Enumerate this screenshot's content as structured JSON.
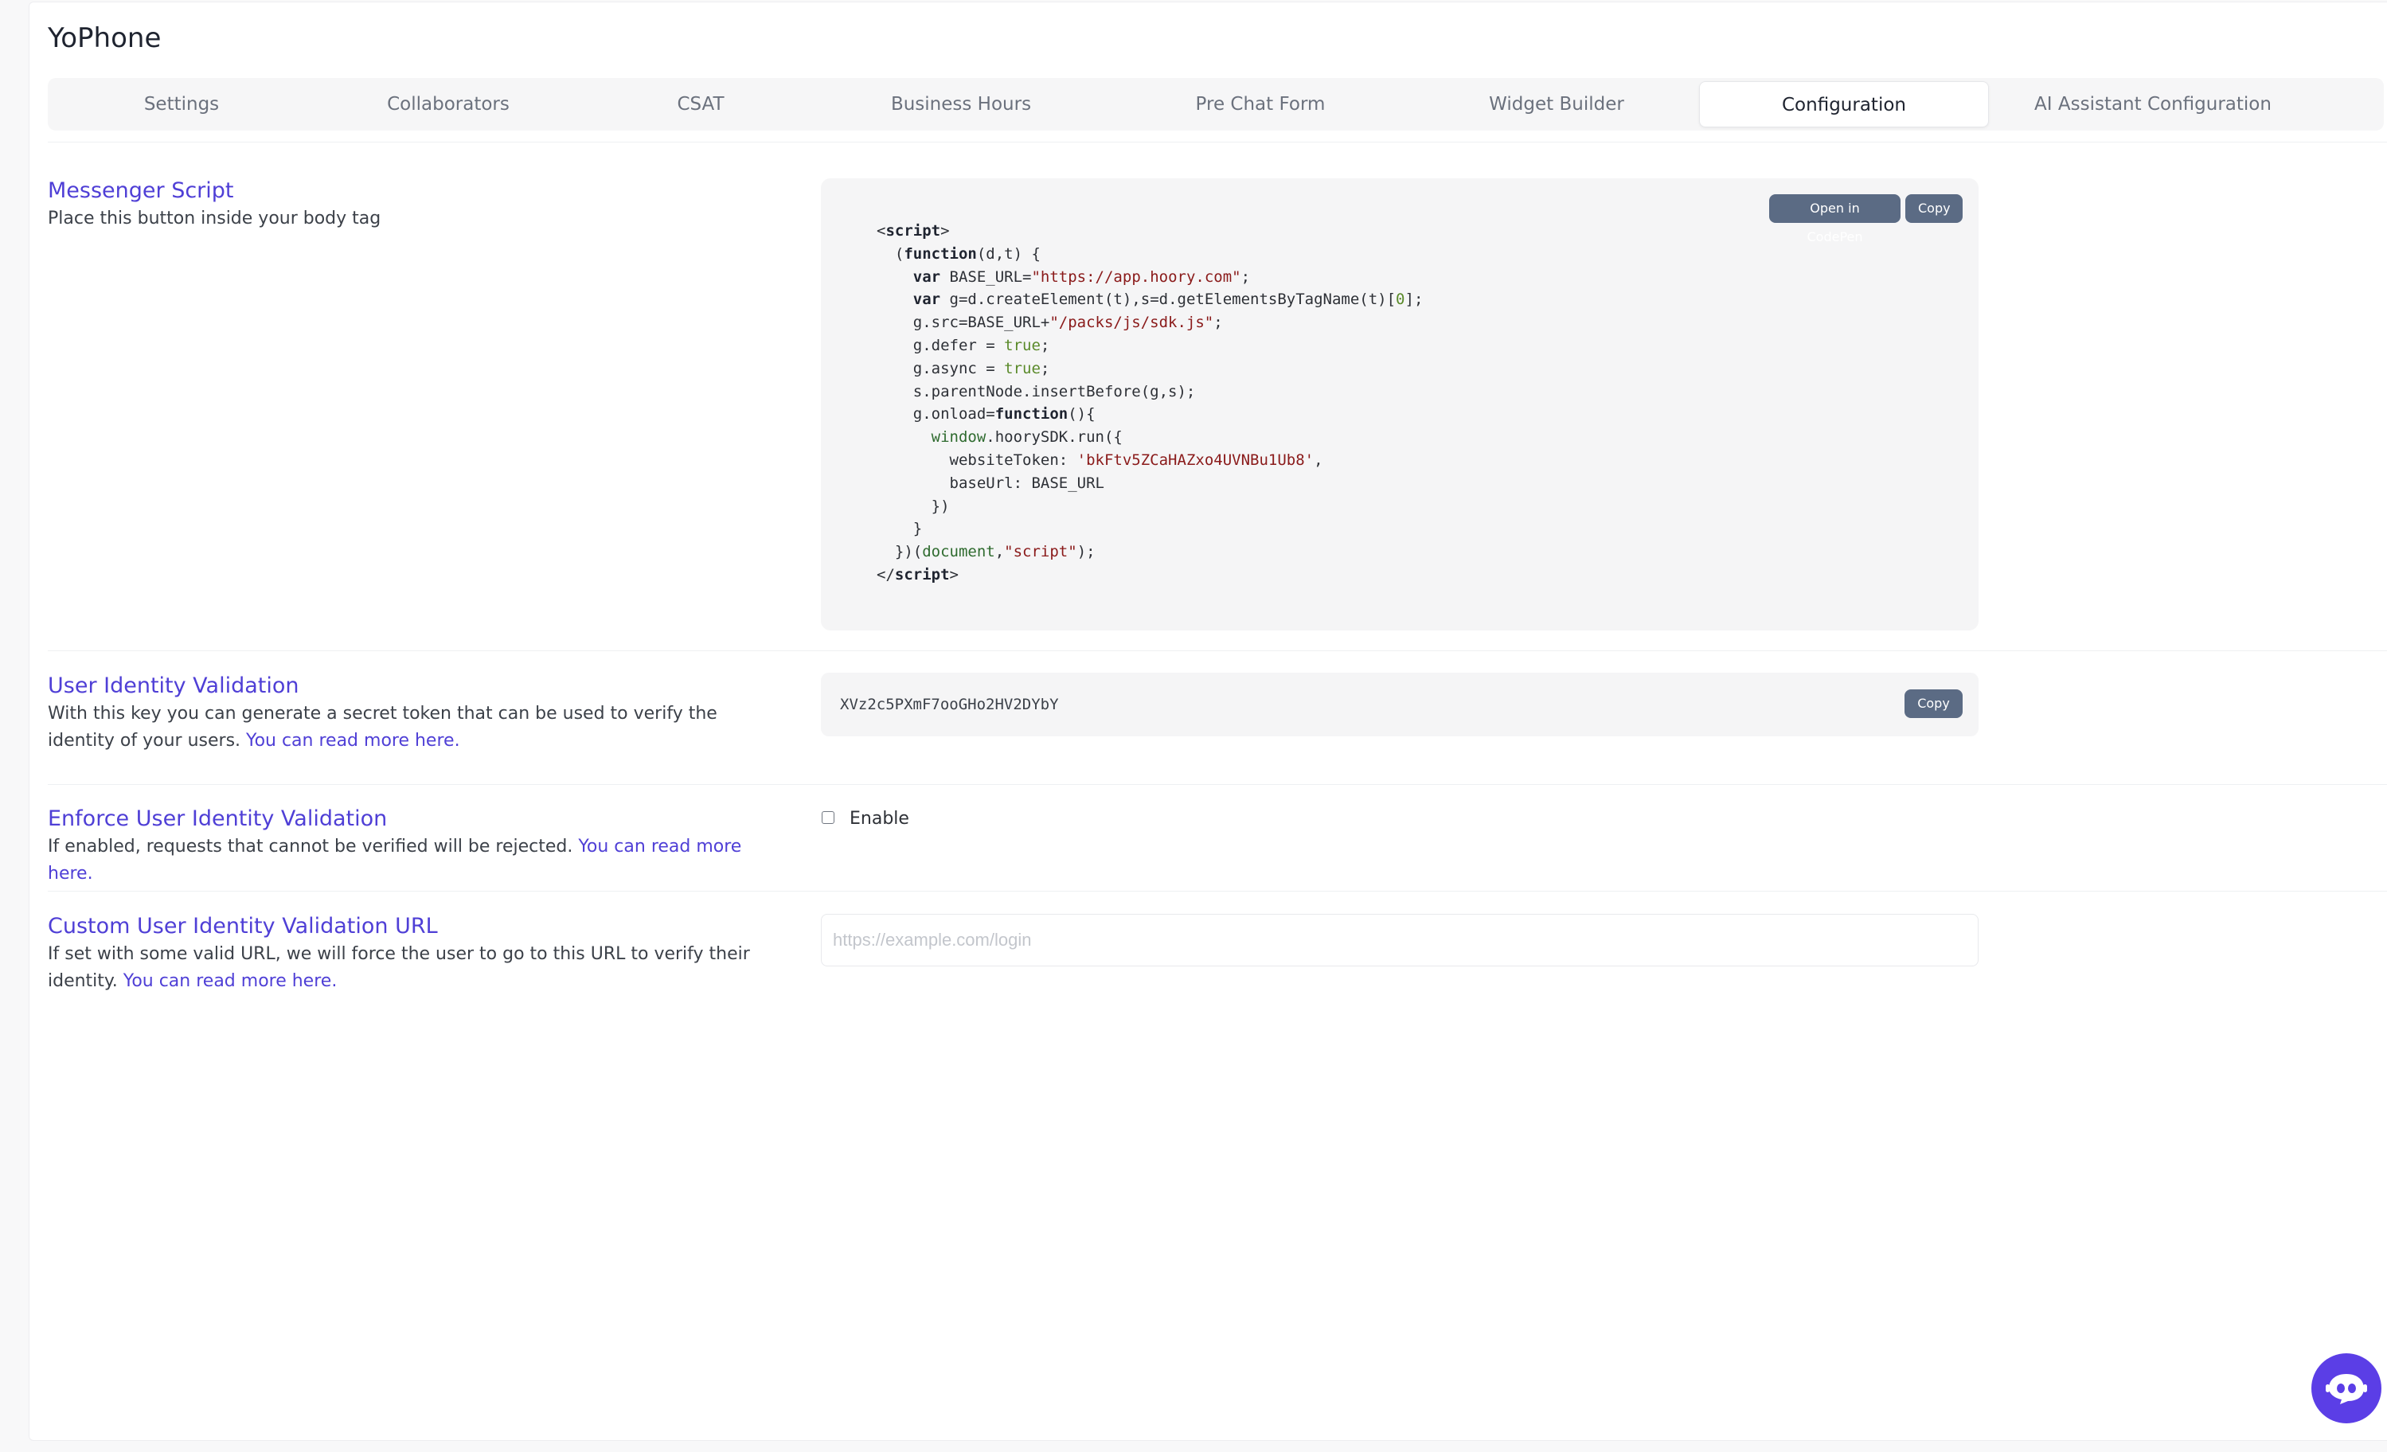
{
  "app": {
    "title": "YoPhone"
  },
  "tabs": [
    {
      "label": "Settings"
    },
    {
      "label": "Collaborators"
    },
    {
      "label": "CSAT"
    },
    {
      "label": "Business Hours"
    },
    {
      "label": "Pre Chat Form"
    },
    {
      "label": "Widget Builder"
    },
    {
      "label": "Configuration",
      "active": true
    },
    {
      "label": "AI Assistant Configuration"
    }
  ],
  "messenger_script": {
    "title": "Messenger Script",
    "description": "Place this button inside your body tag",
    "open_codepen_label": "Open in CodePen",
    "copy_label": "Copy",
    "code": {
      "base_url": "\"https://app.hoory.com\"",
      "sdk_path": "\"/packs/js/sdk.js\"",
      "website_token": "'bkFtv5ZCaHAZxo4UVNBu1Ub8'",
      "script_arg": "\"script\""
    }
  },
  "identity_validation": {
    "title": "User Identity Validation",
    "description": "With this key you can generate a secret token that can be used to verify the identity of your users.",
    "link": "You can read more here.",
    "key": "XVz2c5PXmF7ooGHo2HV2DYbY",
    "copy_label": "Copy"
  },
  "enforce_validation": {
    "title": "Enforce User Identity Validation",
    "description": "If enabled, requests that cannot be verified will be rejected.",
    "link": "You can read more here.",
    "checkbox_label": "Enable",
    "checked": false
  },
  "custom_url": {
    "title": "Custom User Identity Validation URL",
    "description": "If set with some valid URL, we will force the user to go to this URL to verify their identity.",
    "link": "You can read more here.",
    "placeholder": "https://example.com/login",
    "value": ""
  },
  "colors": {
    "accent": "#4f3fd6",
    "button": "#5b6b84",
    "fab": "#5b3ee6"
  },
  "icons": {
    "fab": "chat-bot-icon"
  }
}
